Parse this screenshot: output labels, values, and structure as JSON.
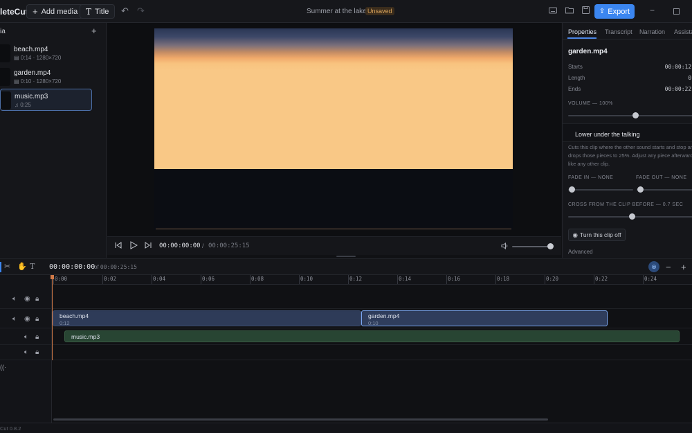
{
  "app": {
    "brand": "leteCut",
    "version": "Cut 0.8.2"
  },
  "topbar": {
    "add_media_label": "Add media",
    "title_label": "Title",
    "project_name": "Summer at the lake",
    "save_status": "Unsaved",
    "export_label": "Export"
  },
  "media": {
    "header": "ia",
    "items": [
      {
        "name": "beach.mp4",
        "meta": "0:14 · 1280×720",
        "kind": "video"
      },
      {
        "name": "garden.mp4",
        "meta": "0:10 · 1280×720",
        "kind": "video"
      },
      {
        "name": "music.mp3",
        "meta": "0:25",
        "kind": "audio"
      }
    ]
  },
  "player": {
    "current_time": "00:00:00:00",
    "separator": "/",
    "total_time": "00:00:25:15",
    "volume": 1.0
  },
  "properties": {
    "tabs": [
      "Properties",
      "Transcript",
      "Narration",
      "Assista"
    ],
    "clip_name": "garden.mp4",
    "starts_label": "Starts",
    "starts_value": "00:00:12:",
    "length_label": "Length",
    "length_value": "0:",
    "ends_label": "Ends",
    "ends_value": "00:00:22:",
    "volume_label": "VOLUME — 100%",
    "lower_title": "Lower under the talking",
    "lower_desc": "Cuts this clip where the other sound starts and stop and drops those pieces to 25%. Adjust any piece afterwards like any other clip.",
    "fade_in_label": "FADE IN — NONE",
    "fade_out_label": "FADE OUT — NONE",
    "crossfade_label": "CROSS FROM THE CLIP BEFORE — 0.7 SEC",
    "turn_off_label": "Turn this clip off",
    "advanced_label": "Advanced"
  },
  "timeline": {
    "current_time": "00:00:00:00",
    "of_label": "of",
    "total_time": "00:00:25:15",
    "ruler": [
      "0:00",
      "0:02",
      "0:04",
      "0:06",
      "0:08",
      "0:10",
      "0:12",
      "0:14",
      "0:16",
      "0:18",
      "0:20",
      "0:22",
      "0:24"
    ],
    "clips": [
      {
        "name": "beach.mp4",
        "duration": "0:12",
        "track": "video",
        "selected": false
      },
      {
        "name": "garden.mp4",
        "duration": "0:10",
        "track": "video",
        "selected": true
      },
      {
        "name": "music.mp3",
        "duration": "",
        "track": "audio",
        "selected": false
      }
    ]
  },
  "colors": {
    "accent": "#3b86f0",
    "playhead": "#d07a48",
    "unsaved": "#d7a25a"
  }
}
